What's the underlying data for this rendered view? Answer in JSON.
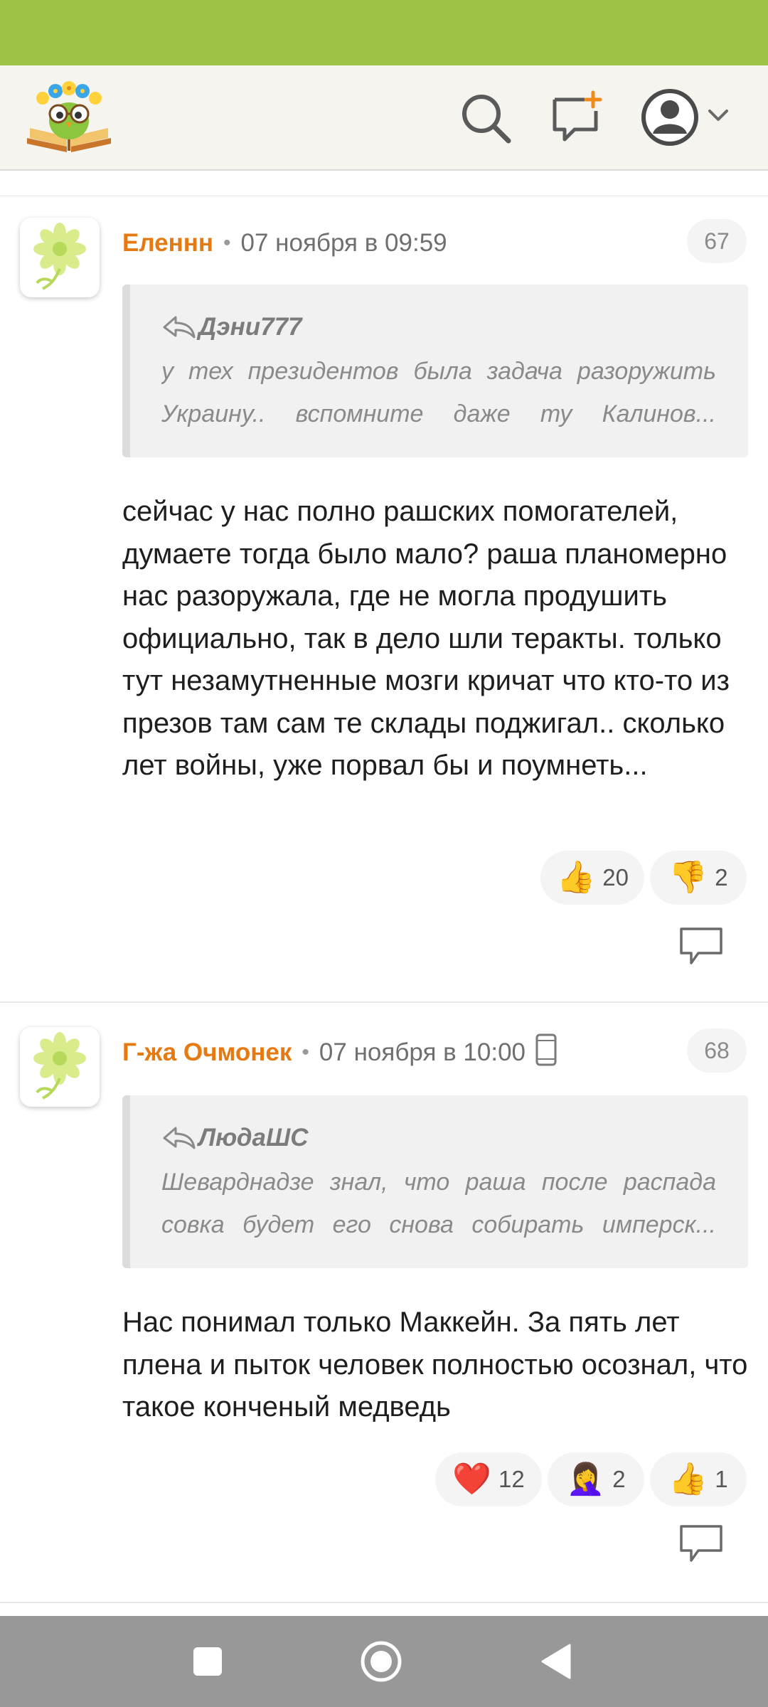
{
  "header": {
    "logo_icon": "owl-book-logo",
    "search_icon": "search-icon",
    "new_post_icon": "new-message-icon",
    "profile_icon": "user-avatar-icon"
  },
  "comments": [
    {
      "author": "Еленнн",
      "date": "07 ноября в 09:59",
      "number": "67",
      "quote_author": "Дэни777",
      "quote_text": "у тех президентов была задача разоружить Украину.. вспомните даже ту Калинов...",
      "text": "сейчас у нас полно рашских помогателей, думаете тогда было мало? раша планомерно нас разоружала, где не могла продушить официально, так в дело шли теракты. только тут незамутненные мозги кричат что кто-то из презов там сам те склады поджигал.. сколько лет войны, уже порвал бы и поумнеть...",
      "reactions": [
        {
          "emoji": "👍",
          "count": "20"
        },
        {
          "emoji": "👎",
          "count": "2"
        }
      ]
    },
    {
      "author": "Г-жа Очмонек",
      "date": "07 ноября в 10:00",
      "number": "68",
      "quote_author": "ЛюдаШС",
      "quote_text": "Шеварднадзе знал, что раша после распада совка будет его снова собирать имперск...",
      "text": "Нас понимал только Маккейн. За пять лет плена и пыток человек полностью осознал, что такое конченый медведь",
      "reactions": [
        {
          "emoji": "❤️",
          "count": "12"
        },
        {
          "emoji": "🤦‍♀️",
          "count": "2"
        },
        {
          "emoji": "👍",
          "count": "1"
        }
      ]
    }
  ],
  "colors": {
    "status_bar": "#9dc244",
    "author": "#e57a12",
    "header_bg": "#f5f4ef",
    "nav_bar": "#989898"
  }
}
